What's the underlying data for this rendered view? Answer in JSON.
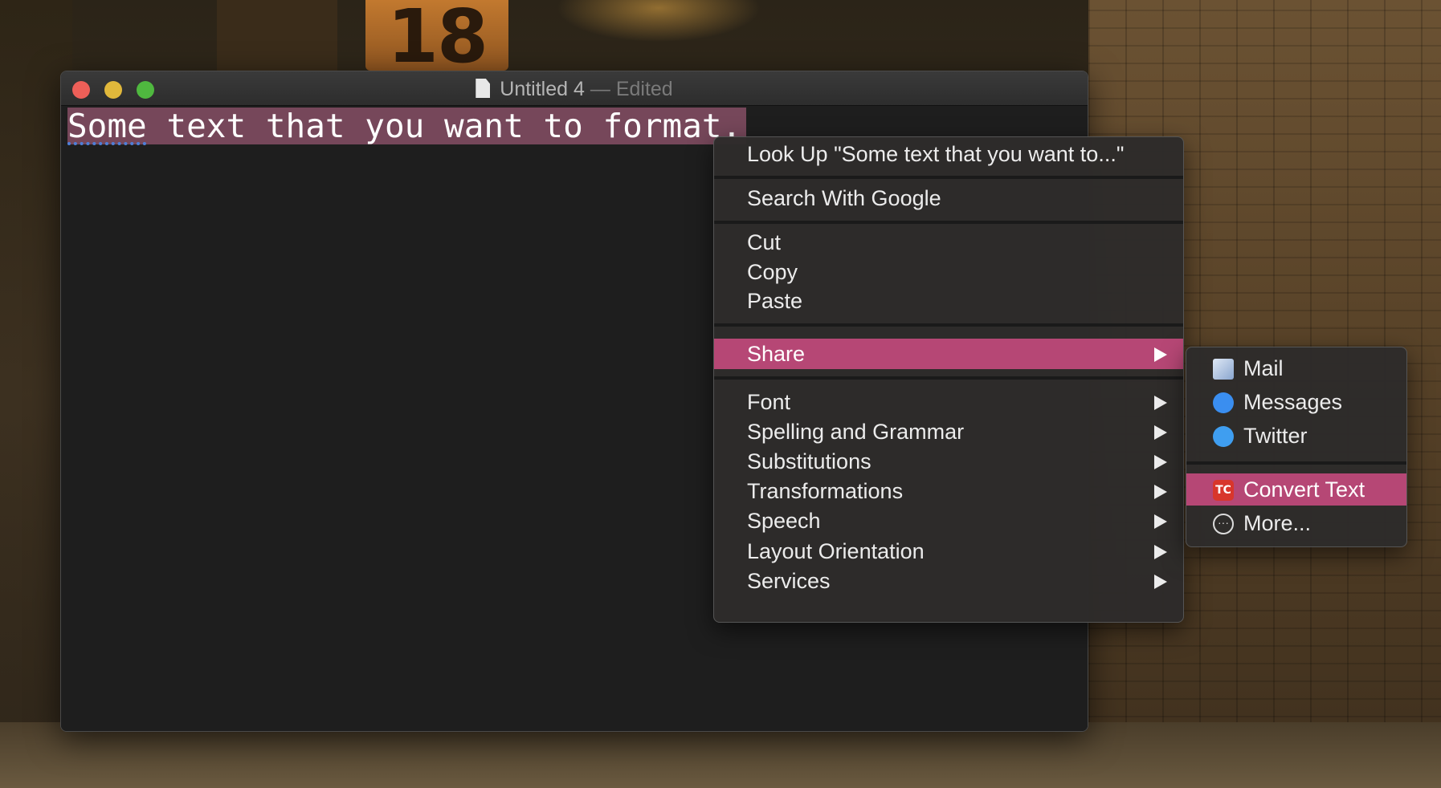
{
  "window": {
    "title": "Untitled 4",
    "title_separator": "—",
    "title_status": "Edited",
    "document_text_misspelled": "Some",
    "document_text_rest": " text that you want to format."
  },
  "context_menu": {
    "look_up": "Look Up \"Some text that you want to...\"",
    "search": "Search With Google",
    "cut": "Cut",
    "copy": "Copy",
    "paste": "Paste",
    "share": "Share",
    "font": "Font",
    "spelling": "Spelling and Grammar",
    "substitutions": "Substitutions",
    "transformations": "Transformations",
    "speech": "Speech",
    "layout": "Layout Orientation",
    "services": "Services"
  },
  "share_menu": {
    "mail": "Mail",
    "messages": "Messages",
    "twitter": "Twitter",
    "convert": "Convert Text",
    "convert_icon_text": "TC",
    "more": "More...",
    "more_icon_text": "···"
  },
  "background": {
    "banner_text": "18"
  },
  "colors": {
    "highlight": "#b64775",
    "selection": "#76475a",
    "close": "#ed5f58",
    "minimize": "#e1b83b",
    "maximize": "#4fb83f"
  }
}
